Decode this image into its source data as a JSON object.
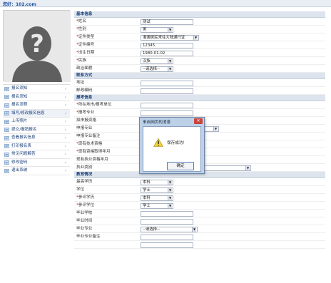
{
  "header": {
    "greeting": "您好：102.com"
  },
  "sidebar": {
    "items": [
      {
        "label": "报名须知",
        "icon": "home-icon"
      },
      {
        "label": "报名须知",
        "icon": "doc-icon"
      },
      {
        "label": "报名流程",
        "icon": "doc-icon"
      },
      {
        "label": "填写/修改报名信息",
        "icon": "edit-icon"
      },
      {
        "label": "上传照片",
        "icon": "upload-icon"
      },
      {
        "label": "提交/撤销报名",
        "icon": "doc-icon"
      },
      {
        "label": "查看报名信息",
        "icon": "doc-icon"
      },
      {
        "label": "打印报名表",
        "icon": "print-icon"
      },
      {
        "label": "常见问题解答",
        "icon": "help-icon"
      },
      {
        "label": "修改密码",
        "icon": "key-icon"
      },
      {
        "label": "退出系统",
        "icon": "exit-icon"
      }
    ]
  },
  "sections": {
    "basic": {
      "title": "基本信息",
      "rows": [
        {
          "label": "姓名",
          "req": "*",
          "type": "text",
          "value": "测试"
        },
        {
          "label": "性别",
          "req": "*",
          "type": "select",
          "value": "男"
        },
        {
          "label": "证件类型",
          "req": "*",
          "type": "select",
          "value": "港澳居民来往大陆通行证"
        },
        {
          "label": "证件编号",
          "req": "*",
          "type": "text",
          "value": "12345"
        },
        {
          "label": "出生日期",
          "req": "*",
          "type": "text",
          "value": "1980-01-02"
        },
        {
          "label": "民族",
          "req": "*",
          "type": "select",
          "value": "汉族"
        },
        {
          "label": "政治面貌",
          "req": "",
          "type": "select",
          "value": "--请选择--"
        }
      ]
    },
    "contact": {
      "title": "联系方式",
      "rows": [
        {
          "label": "地址",
          "req": "",
          "type": "text",
          "value": ""
        },
        {
          "label": "邮政编码",
          "req": "",
          "type": "text",
          "value": ""
        }
      ]
    },
    "apply": {
      "title": "报考信息",
      "rows": [
        {
          "label": "所在地市/报考单位",
          "req": "*",
          "type": "text",
          "value": ""
        },
        {
          "label": "报考专业",
          "req": "*",
          "type": "text",
          "value": ""
        },
        {
          "label": "拟申报资格",
          "req": "",
          "type": "text",
          "value": ""
        },
        {
          "label": "申报专业",
          "req": "",
          "type": "select",
          "value": ""
        },
        {
          "label": "申报专业备注",
          "req": "",
          "type": "text",
          "value": ""
        },
        {
          "label": "现有技术资格",
          "req": "*",
          "type": "text",
          "value": ""
        },
        {
          "label": "现有资格取得年月",
          "req": "*",
          "type": "text",
          "value": ""
        },
        {
          "label": "现有执业资格年月",
          "req": "",
          "type": "text",
          "value": ""
        },
        {
          "label": "执业类别",
          "req": "",
          "type": "select",
          "value": "--请选择--"
        }
      ]
    },
    "edu": {
      "title": "教育情况",
      "rows": [
        {
          "label": "最高学历",
          "req": "",
          "type": "select",
          "value": "本科"
        },
        {
          "label": "学位",
          "req": "",
          "type": "select",
          "value": "学士"
        },
        {
          "label": "参评学历",
          "req": "*",
          "type": "select",
          "value": "本科"
        },
        {
          "label": "参评学位",
          "req": "*",
          "type": "select",
          "value": "学士"
        },
        {
          "label": "毕业学校",
          "req": "",
          "type": "text",
          "value": ""
        },
        {
          "label": "毕业时间",
          "req": "",
          "type": "text",
          "value": ""
        },
        {
          "label": "毕业专业",
          "req": "",
          "type": "select",
          "value": "--请选择--"
        },
        {
          "label": "毕业专业备注",
          "req": "",
          "type": "text",
          "value": ""
        },
        {
          "label": "",
          "req": "",
          "type": "text",
          "value": ""
        }
      ]
    }
  },
  "dialog": {
    "title": "来自网页的消息",
    "close": "✕",
    "message": "保存成功！",
    "ok": "确定"
  }
}
